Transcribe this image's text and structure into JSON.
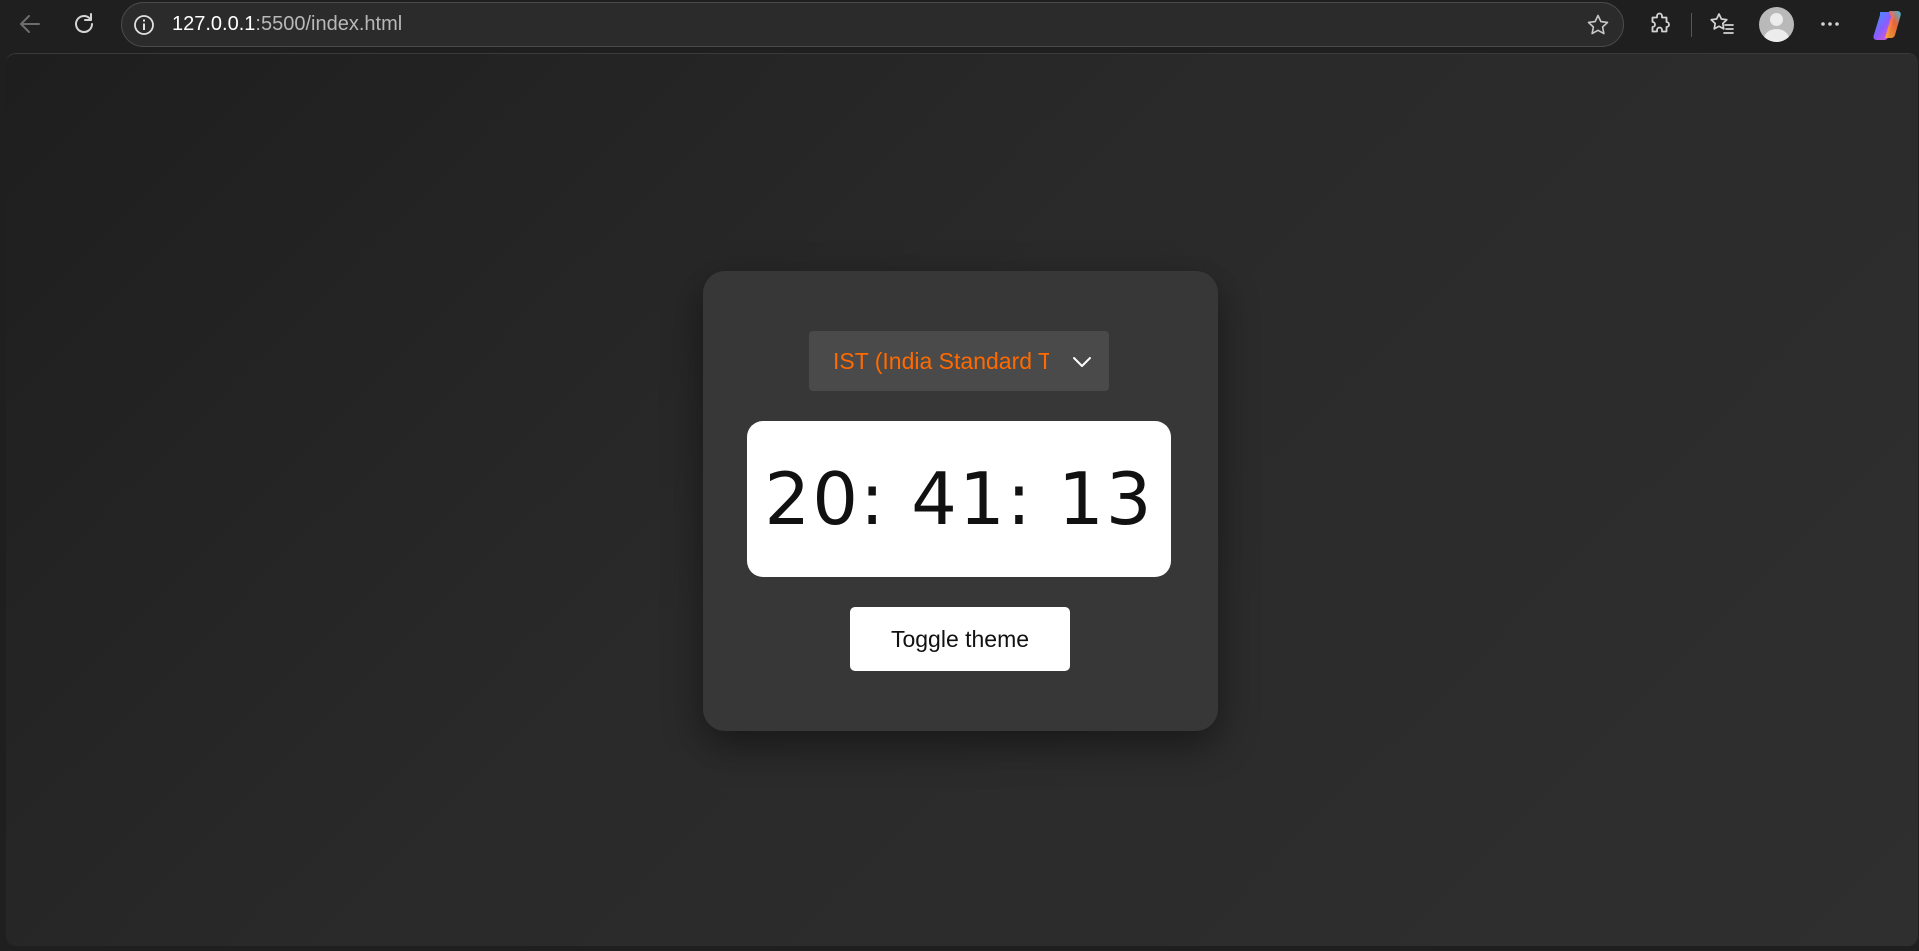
{
  "browser": {
    "address": {
      "host": "127.0.0.1",
      "path": ":5500/index.html"
    },
    "icons": {
      "back": "back-arrow-icon",
      "reload": "reload-icon",
      "site_info": "info-icon",
      "favorite": "star-icon",
      "extensions": "puzzle-icon",
      "favorites": "favorites-icon",
      "profile": "avatar-icon",
      "more": "more-icon",
      "copilot": "copilot-icon"
    }
  },
  "app": {
    "timezone_select": {
      "selected": "IST (India Standard Time)"
    },
    "clock": {
      "time": "20: 41: 13"
    },
    "toggle_label": "Toggle theme"
  },
  "colors": {
    "accent": "#ff6a00",
    "card": "#373737",
    "background": "#2a2a2a"
  }
}
